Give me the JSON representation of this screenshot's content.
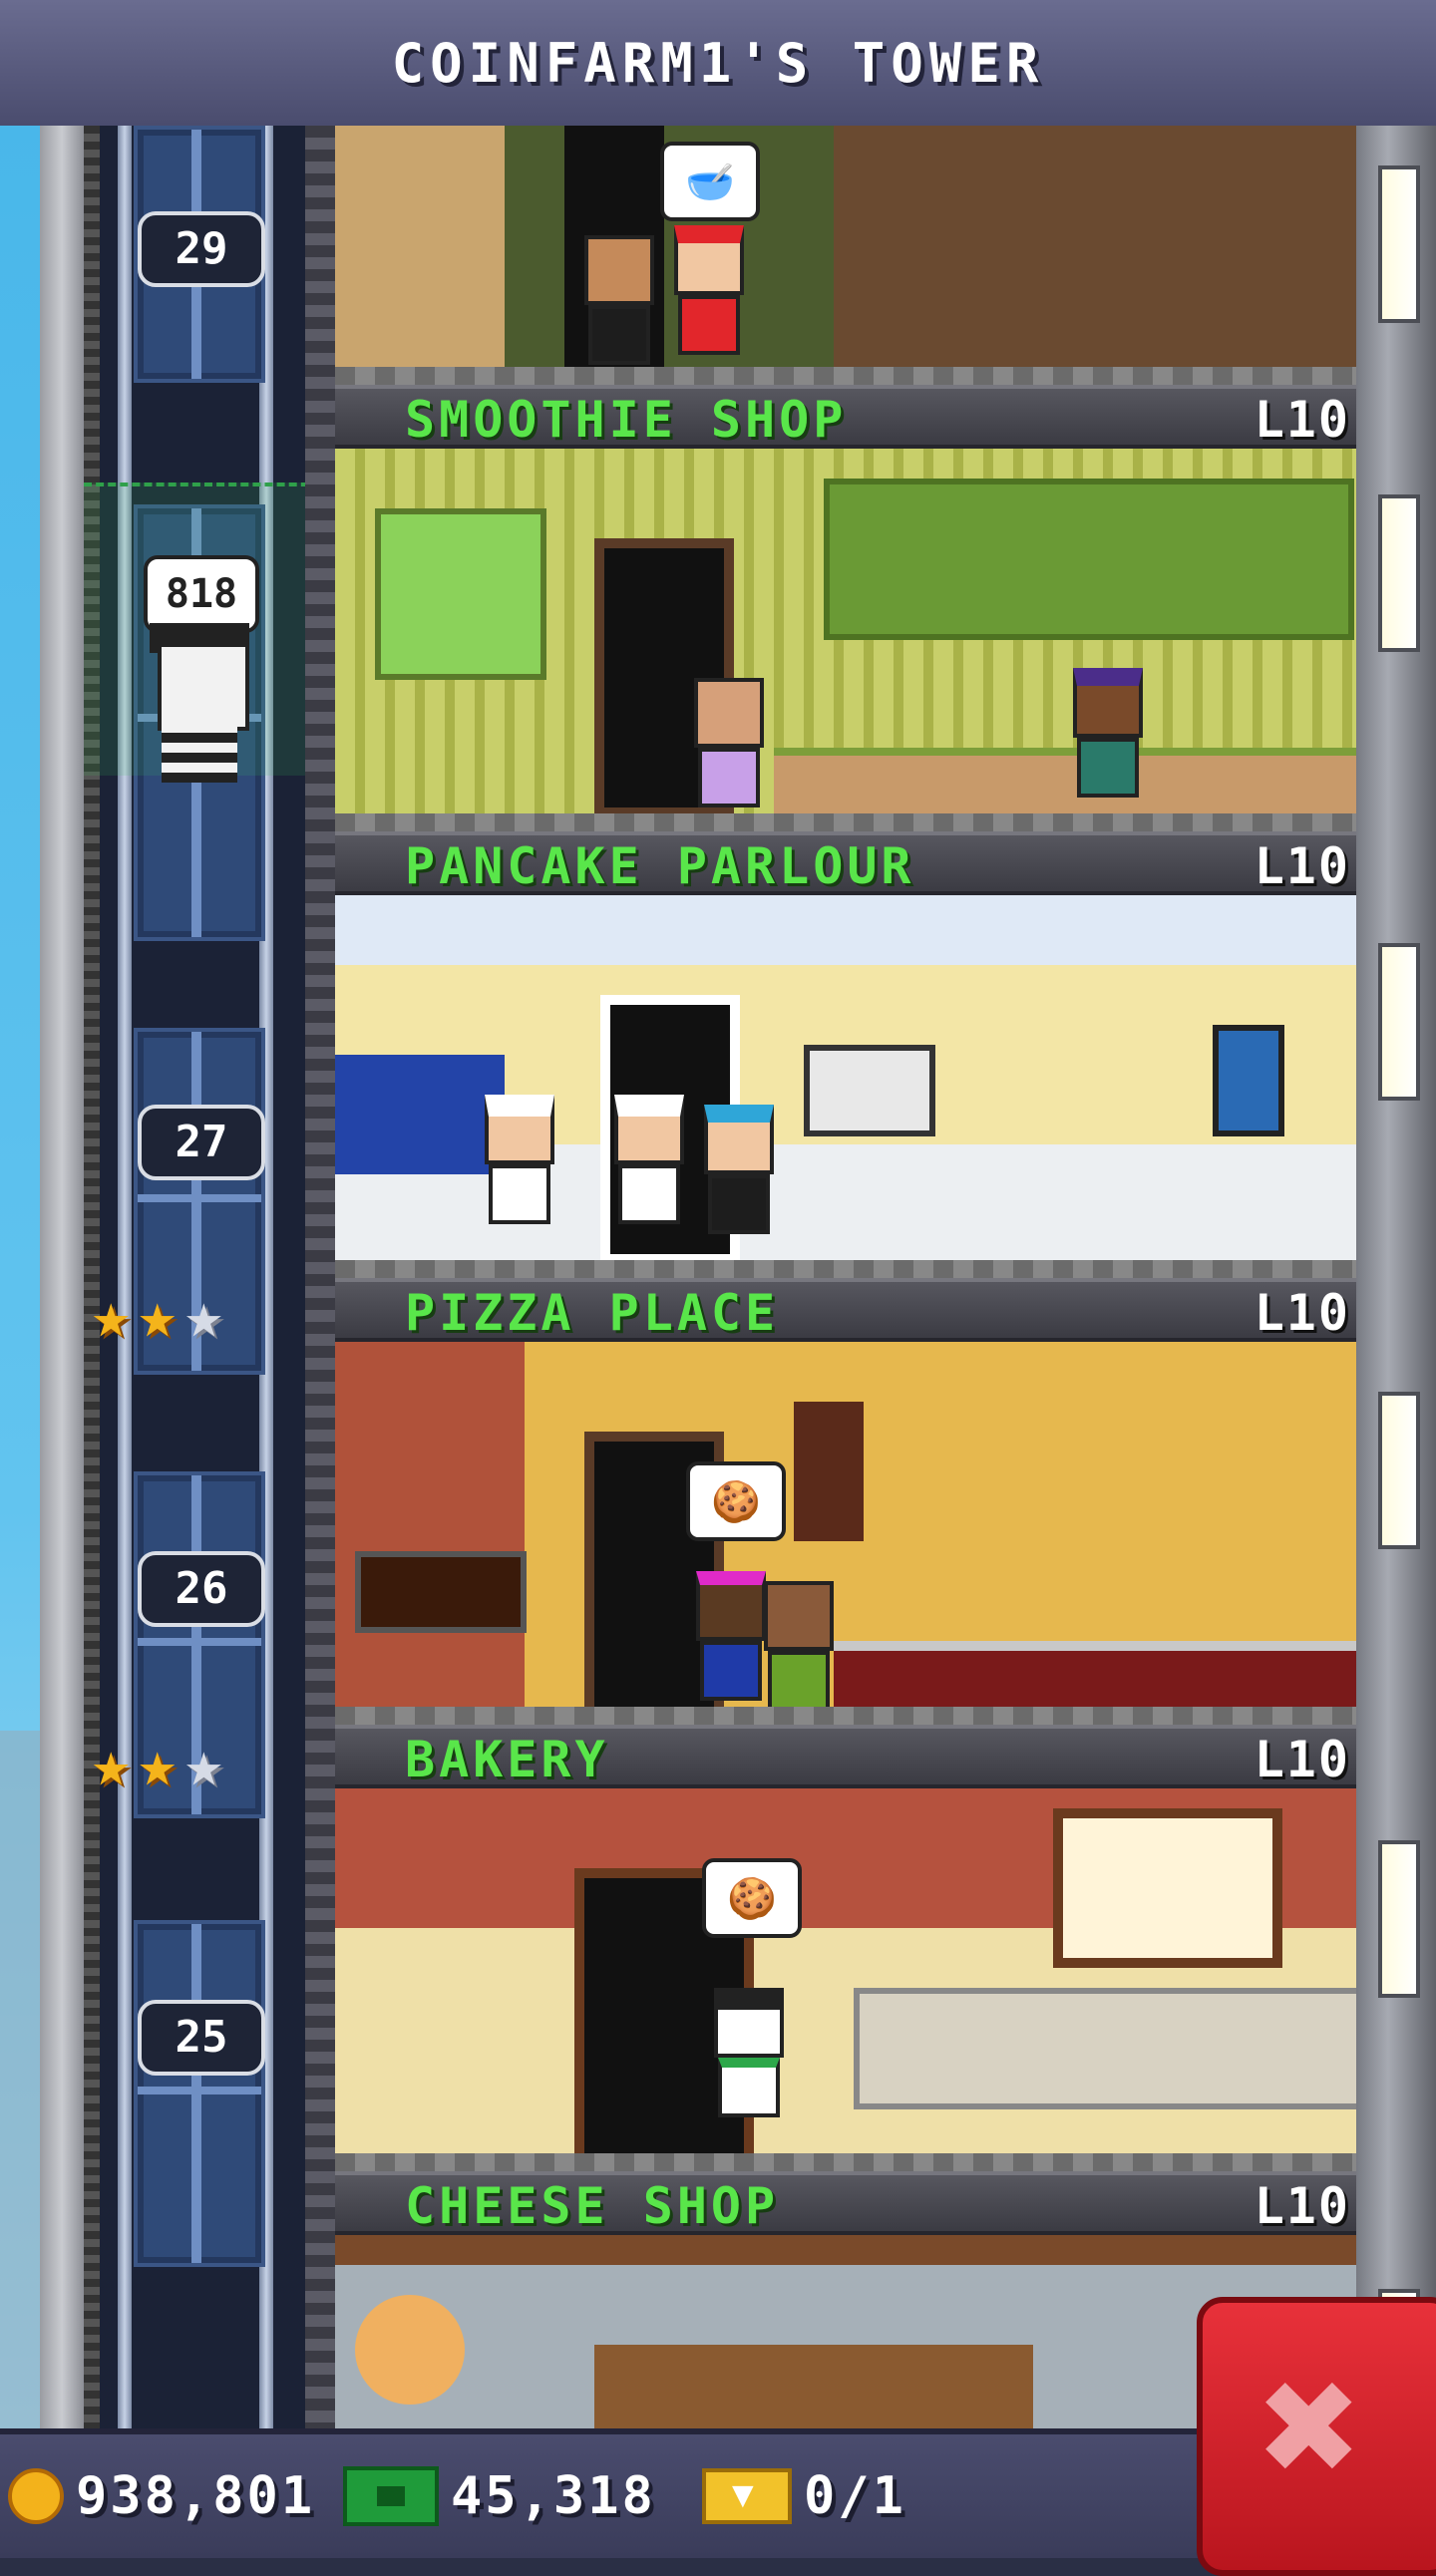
{
  "header": {
    "title": "COINFARM1'S TOWER"
  },
  "elevator": {
    "floor_numbers": [
      "29",
      "27",
      "26",
      "25"
    ],
    "passenger_bubble": "818",
    "star_rows": [
      {
        "gold": 2,
        "silver": 1
      },
      {
        "gold": 2,
        "silver": 1
      }
    ]
  },
  "floors": [
    {
      "name": "SMOOTHIE SHOP",
      "level": "L10"
    },
    {
      "name": "PANCAKE PARLOUR",
      "level": "L10"
    },
    {
      "name": "PIZZA PLACE",
      "level": "L10"
    },
    {
      "name": "BAKERY",
      "level": "L10"
    },
    {
      "name": "CHEESE SHOP",
      "level": "L10"
    }
  ],
  "status": {
    "coins": "938,801",
    "bux": "45,318",
    "tickets": "0/1"
  },
  "icons": {
    "star": "★",
    "close": "✖"
  },
  "colors": {
    "floor_name": "#59e64a",
    "close_button": "#e8313a",
    "coin": "#f3b21b",
    "bux": "#1f9b3a"
  }
}
